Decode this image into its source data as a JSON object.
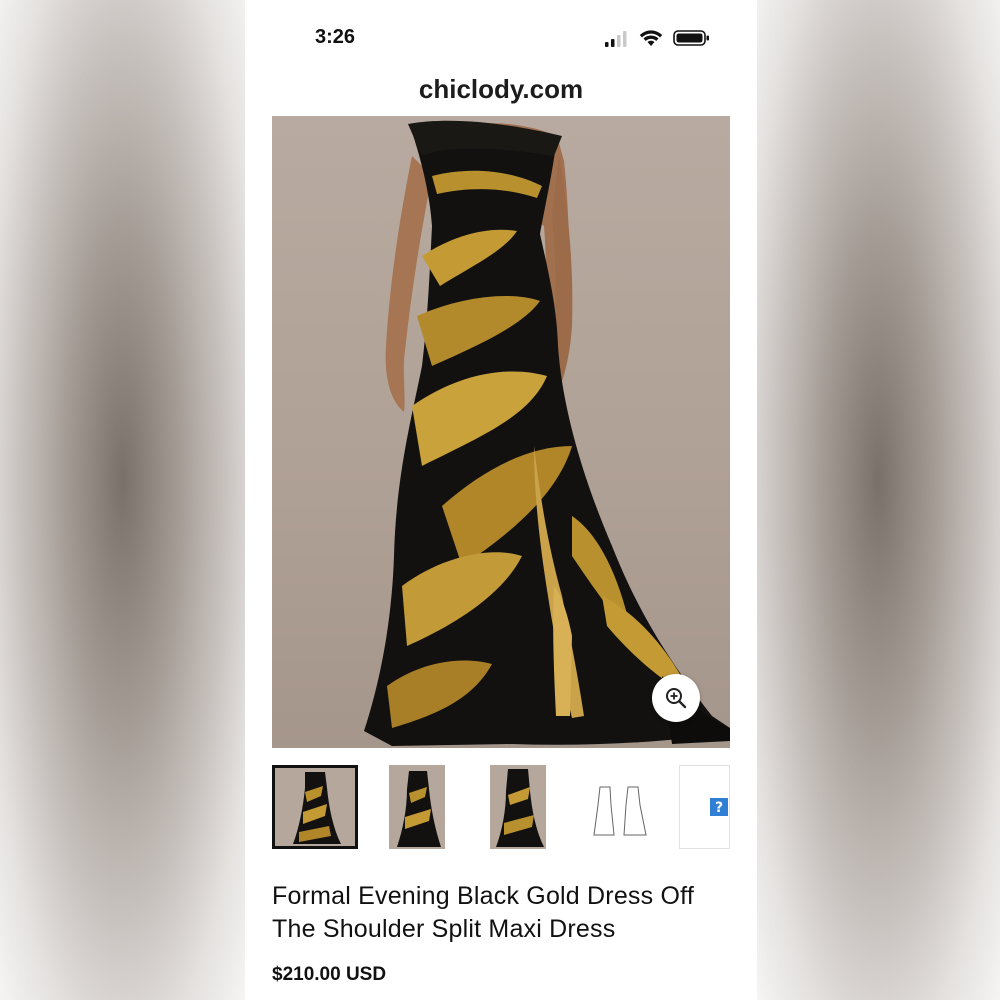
{
  "status_bar": {
    "time": "3:26",
    "icons": [
      "signal-icon",
      "wifi-icon",
      "battery-icon"
    ]
  },
  "browser": {
    "url": "chiclody.com"
  },
  "product": {
    "main_image": "black-gold-dress-photo",
    "zoom_icon": "zoom-in-icon",
    "thumbnails": [
      {
        "name": "thumbnail-front",
        "selected": true
      },
      {
        "name": "thumbnail-side"
      },
      {
        "name": "thumbnail-back"
      },
      {
        "name": "thumbnail-sketch"
      },
      {
        "name": "thumbnail-size-chart"
      }
    ],
    "title": "Formal Evening Black Gold Dress Off The Shoulder Split Maxi Dress",
    "price": "$210.00 USD"
  },
  "colors": {
    "dress_black": "#121110",
    "dress_gold": "#b8902e",
    "backdrop": "#b5a79c"
  }
}
